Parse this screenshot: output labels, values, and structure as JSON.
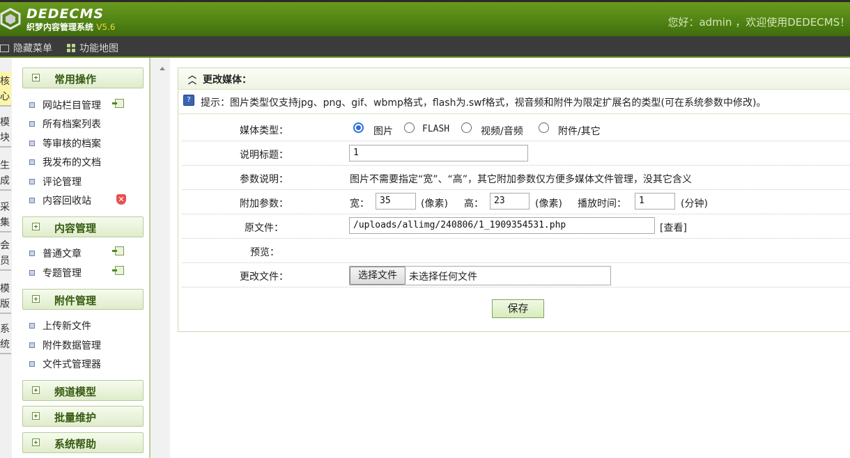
{
  "header": {
    "logo_title": "DEDECMS",
    "logo_subtitle": "织梦内容管理系统",
    "version": "V5.6",
    "greeting": "您好：admin ，欢迎使用DEDECMS！  主"
  },
  "toolbar": {
    "hide_menu": "隐藏菜单",
    "site_map": "功能地图"
  },
  "vertical_tabs": [
    "核心",
    "模块",
    "生成",
    "采集",
    "会员",
    "模版",
    "系统"
  ],
  "left_menu": {
    "group1": {
      "title": "常用操作",
      "items": [
        "网站栏目管理",
        "所有档案列表",
        "等审核的档案",
        "我发布的文档",
        "评论管理",
        "内容回收站"
      ]
    },
    "group2": {
      "title": "内容管理",
      "items": [
        "普通文章",
        "专题管理"
      ]
    },
    "group3": {
      "title": "附件管理",
      "items": [
        "上传新文件",
        "附件数据管理",
        "文件式管理器"
      ]
    },
    "group4": {
      "title": "频道模型"
    },
    "group5": {
      "title": "批量维护"
    },
    "group6": {
      "title": "系统帮助"
    }
  },
  "panel": {
    "title": "更改媒体：",
    "tip": "提示：图片类型仅支持jpg、png、gif、wbmp格式，flash为.swf格式，视音频和附件为限定扩展名的类型(可在系统参数中修改)。",
    "media_type": {
      "label": "媒体类型：",
      "options": [
        "图片",
        "FLASH",
        "视频/音频",
        "附件/其它"
      ],
      "selected": "图片"
    },
    "title_field": {
      "label": "说明标题：",
      "value": "1"
    },
    "param_desc": {
      "label": "参数说明：",
      "text": "图片不需要指定“宽”、“高”，其它附加参数仅方便多媒体文件管理，没其它含义"
    },
    "extra": {
      "label": "附加参数：",
      "width_label": "宽：",
      "width_value": "35",
      "width_unit": "(像素)",
      "height_label": "高：",
      "height_value": "23",
      "height_unit": "(像素)",
      "time_label": "播放时间：",
      "time_value": "1",
      "time_unit": "(分钟)"
    },
    "source": {
      "label": "原文件：",
      "value": "/uploads/allimg/240806/1_1909354531.php",
      "view_link": "[查看]"
    },
    "preview": {
      "label": "预览："
    },
    "change_file": {
      "label": "更改文件：",
      "button": "选择文件",
      "status": "未选择任何文件"
    },
    "save_button": "保存"
  },
  "colors": {
    "brand_green": "#4f8114",
    "header_dark": "#3b3b3b",
    "accent_yellow": "#f3d437"
  }
}
